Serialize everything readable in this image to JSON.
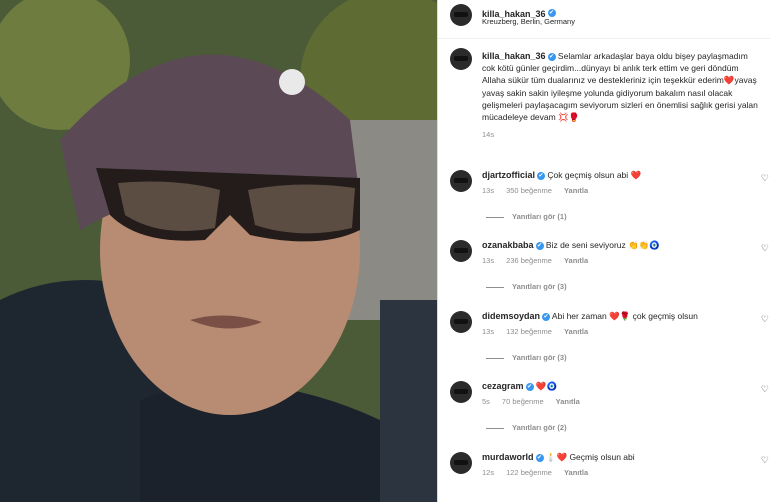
{
  "post": {
    "author": "killa_hakan_36",
    "location": "Kreuzberg, Berlin, Germany",
    "caption_text": "Selamlar arkadaşlar baya oldu bişey paylaşmadım cok kötü günler geçirdim...dünyayı bi anlık terk ettim ve geri döndüm Allaha sükür tüm dualarınız ve destekleriniz için teşekkür ederim",
    "caption_heart": "❤️",
    "caption_text2": "yavaş yavaş sakin sakin iyileşme yolunda gidiyorum bakalım nasıl olacak gelişmeleri paylaşacagım seviyorum sizleri en önemlisi sağlık gerisi yalan mücadeleye devam",
    "caption_emojis": "💢🥊",
    "time": "14s"
  },
  "comments": [
    {
      "user": "djartzofficial",
      "text": "Çok geçmiş olsun abi",
      "emoji": "❤️",
      "time": "13s",
      "likes": "350 beğenme",
      "reply": "Yanıtla",
      "view_replies": "Yanıtları gör (1)"
    },
    {
      "user": "ozanakbaba",
      "text": "Biz de seni seviyoruz",
      "emoji": "👏👏🧿",
      "time": "13s",
      "likes": "236 beğenme",
      "reply": "Yanıtla",
      "view_replies": "Yanıtları gör (3)"
    },
    {
      "user": "didemsoydan",
      "text": "Abi her zaman",
      "emoji": "❤️🌹",
      "text2": "çok geçmiş olsun",
      "time": "13s",
      "likes": "132 beğenme",
      "reply": "Yanıtla",
      "view_replies": "Yanıtları gör (3)"
    },
    {
      "user": "cezagram",
      "text": "",
      "emoji": "❤️🧿",
      "time": "5s",
      "likes": "70 beğenme",
      "reply": "Yanıtla",
      "view_replies": "Yanıtları gör (2)"
    },
    {
      "user": "murdaworld",
      "text": "Geçmiş olsun abi",
      "emoji": "🕯️❤️",
      "time": "12s",
      "likes": "122 beğenme",
      "reply": "Yanıtla"
    }
  ],
  "icons": {
    "verified": "✔",
    "like": "♡"
  }
}
